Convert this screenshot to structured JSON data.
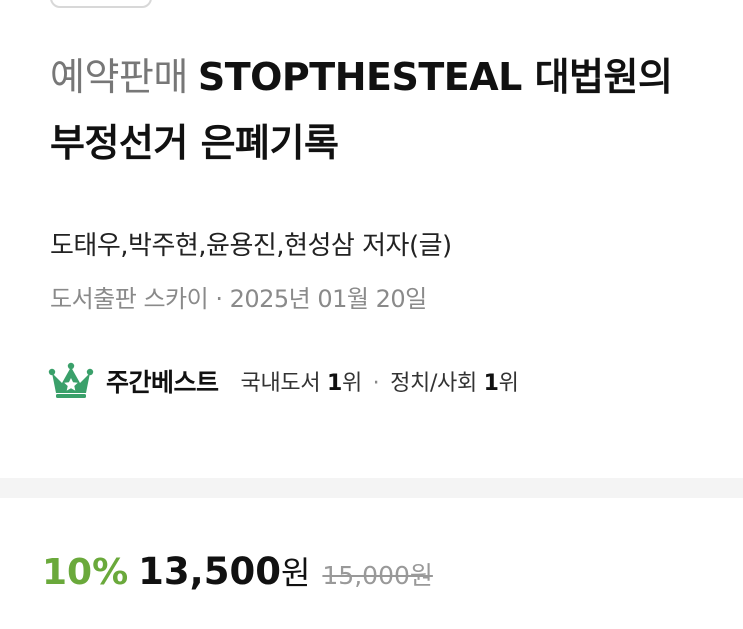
{
  "book": {
    "tag": "예약판매",
    "title": "STOPTHESTEAL 대법원의 부정선거 은폐기록",
    "authors": "도태우,박주현,윤용진,현성삼 저자(글)",
    "publisher_date": "도서출판 스카이 · 2025년 01월 20일"
  },
  "bestseller": {
    "icon": "crown-icon",
    "label": "주간베스트",
    "rank1_category": "국내도서",
    "rank1_value": "1",
    "rank1_unit": "위",
    "separator": "·",
    "rank2_category": "정치/사회",
    "rank2_value": "1",
    "rank2_unit": "위"
  },
  "price": {
    "discount": "10%",
    "sale_price": "13,500",
    "sale_unit": "원",
    "original_price": "15,000원"
  },
  "colors": {
    "accent_green": "#6aa93b",
    "crown_green": "#3aa06a",
    "muted_text": "#8a8a8a"
  }
}
